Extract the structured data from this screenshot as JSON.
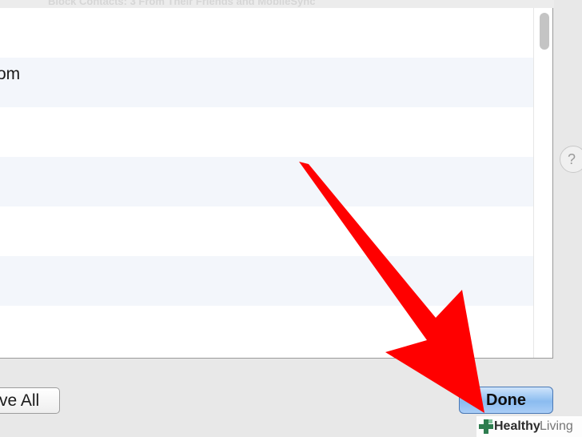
{
  "dialog": {
    "header_partial_text": "Block Contacts: 3 From Their Friends and MobileSync",
    "list_rows": [
      {
        "text": ""
      },
      {
        "text": "om"
      },
      {
        "text": ""
      },
      {
        "text": ""
      },
      {
        "text": ""
      },
      {
        "text": ""
      },
      {
        "text": ""
      }
    ],
    "remove_all_label": "ve All",
    "done_label": "Done",
    "side_help_glyph": "?"
  },
  "annotation": {
    "arrow_color": "#ff0000",
    "arrow_target": "done-button"
  },
  "watermark": {
    "healthy": "Healthy",
    "living": "Living"
  },
  "colors": {
    "done_button": "#8bbcf0",
    "row_alt": "#f3f6fb",
    "watermark_plus": "#2e7d4f"
  }
}
